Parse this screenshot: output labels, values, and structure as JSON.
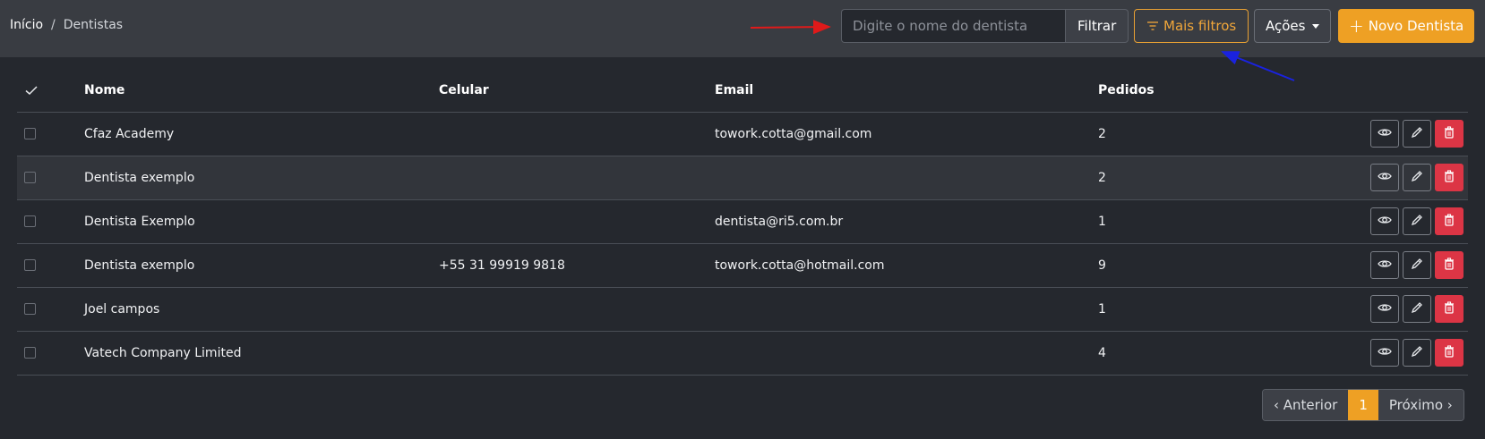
{
  "breadcrumb": {
    "home": "Início",
    "separator": "/",
    "current": "Dentistas"
  },
  "toolbar": {
    "search_placeholder": "Digite o nome do dentista",
    "filter_label": "Filtrar",
    "more_filters_label": "Mais filtros",
    "actions_label": "Ações",
    "new_label": "Novo Dentista"
  },
  "table": {
    "headers": {
      "nome": "Nome",
      "celular": "Celular",
      "email": "Email",
      "pedidos": "Pedidos"
    },
    "rows": [
      {
        "nome": "Cfaz Academy",
        "celular": "",
        "email": "towork.cotta@gmail.com",
        "pedidos": "2"
      },
      {
        "nome": "Dentista exemplo",
        "celular": "",
        "email": "",
        "pedidos": "2"
      },
      {
        "nome": "Dentista Exemplo",
        "celular": "",
        "email": "dentista@ri5.com.br",
        "pedidos": "1"
      },
      {
        "nome": "Dentista exemplo",
        "celular": "+55 31 99919 9818",
        "email": "towork.cotta@hotmail.com",
        "pedidos": "9"
      },
      {
        "nome": "Joel campos",
        "celular": "",
        "email": "",
        "pedidos": "1"
      },
      {
        "nome": "Vatech Company Limited",
        "celular": "",
        "email": "",
        "pedidos": "4"
      }
    ]
  },
  "pagination": {
    "prev": "‹ Anterior",
    "current": "1",
    "next": "Próximo ›"
  },
  "colors": {
    "accent": "#eea024",
    "danger": "#dc3545",
    "annotation_red": "#e01a1a",
    "annotation_blue": "#1a22e0"
  },
  "icons": [
    "check-icon",
    "filter-icon",
    "plus-icon",
    "eye-icon",
    "pencil-icon",
    "trash-icon",
    "caret-down-icon"
  ]
}
